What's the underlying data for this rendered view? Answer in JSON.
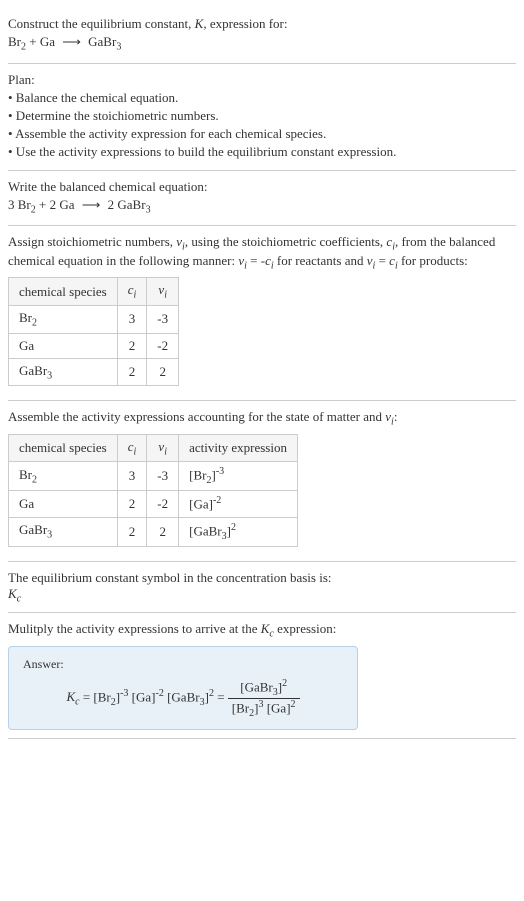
{
  "header": {
    "title": "Construct the equilibrium constant, K, expression for:",
    "equation": "Br₂ + Ga ⟶ GaBr₃"
  },
  "plan": {
    "title": "Plan:",
    "items": [
      "• Balance the chemical equation.",
      "• Determine the stoichiometric numbers.",
      "• Assemble the activity expression for each chemical species.",
      "• Use the activity expressions to build the equilibrium constant expression."
    ]
  },
  "balanced": {
    "title": "Write the balanced chemical equation:",
    "equation": "3 Br₂ + 2 Ga ⟶ 2 GaBr₃"
  },
  "stoich": {
    "intro": "Assign stoichiometric numbers, νᵢ, using the stoichiometric coefficients, cᵢ, from the balanced chemical equation in the following manner: νᵢ = -cᵢ for reactants and νᵢ = cᵢ for products:",
    "headers": [
      "chemical species",
      "cᵢ",
      "νᵢ"
    ],
    "rows": [
      {
        "species": "Br₂",
        "c": "3",
        "v": "-3"
      },
      {
        "species": "Ga",
        "c": "2",
        "v": "-2"
      },
      {
        "species": "GaBr₃",
        "c": "2",
        "v": "2"
      }
    ]
  },
  "activity": {
    "intro": "Assemble the activity expressions accounting for the state of matter and νᵢ:",
    "headers": [
      "chemical species",
      "cᵢ",
      "νᵢ",
      "activity expression"
    ],
    "rows": [
      {
        "species": "Br₂",
        "c": "3",
        "v": "-3",
        "expr": "[Br₂]⁻³"
      },
      {
        "species": "Ga",
        "c": "2",
        "v": "-2",
        "expr": "[Ga]⁻²"
      },
      {
        "species": "GaBr₃",
        "c": "2",
        "v": "2",
        "expr": "[GaBr₃]²"
      }
    ]
  },
  "symbol": {
    "intro": "The equilibrium constant symbol in the concentration basis is:",
    "value": "K_c"
  },
  "final": {
    "intro": "Mulitply the activity expressions to arrive at the K_c expression:",
    "answer_label": "Answer:",
    "lhs": "K_c = [Br₂]⁻³ [Ga]⁻² [GaBr₃]² =",
    "num": "[GaBr₃]²",
    "den": "[Br₂]³ [Ga]²"
  }
}
